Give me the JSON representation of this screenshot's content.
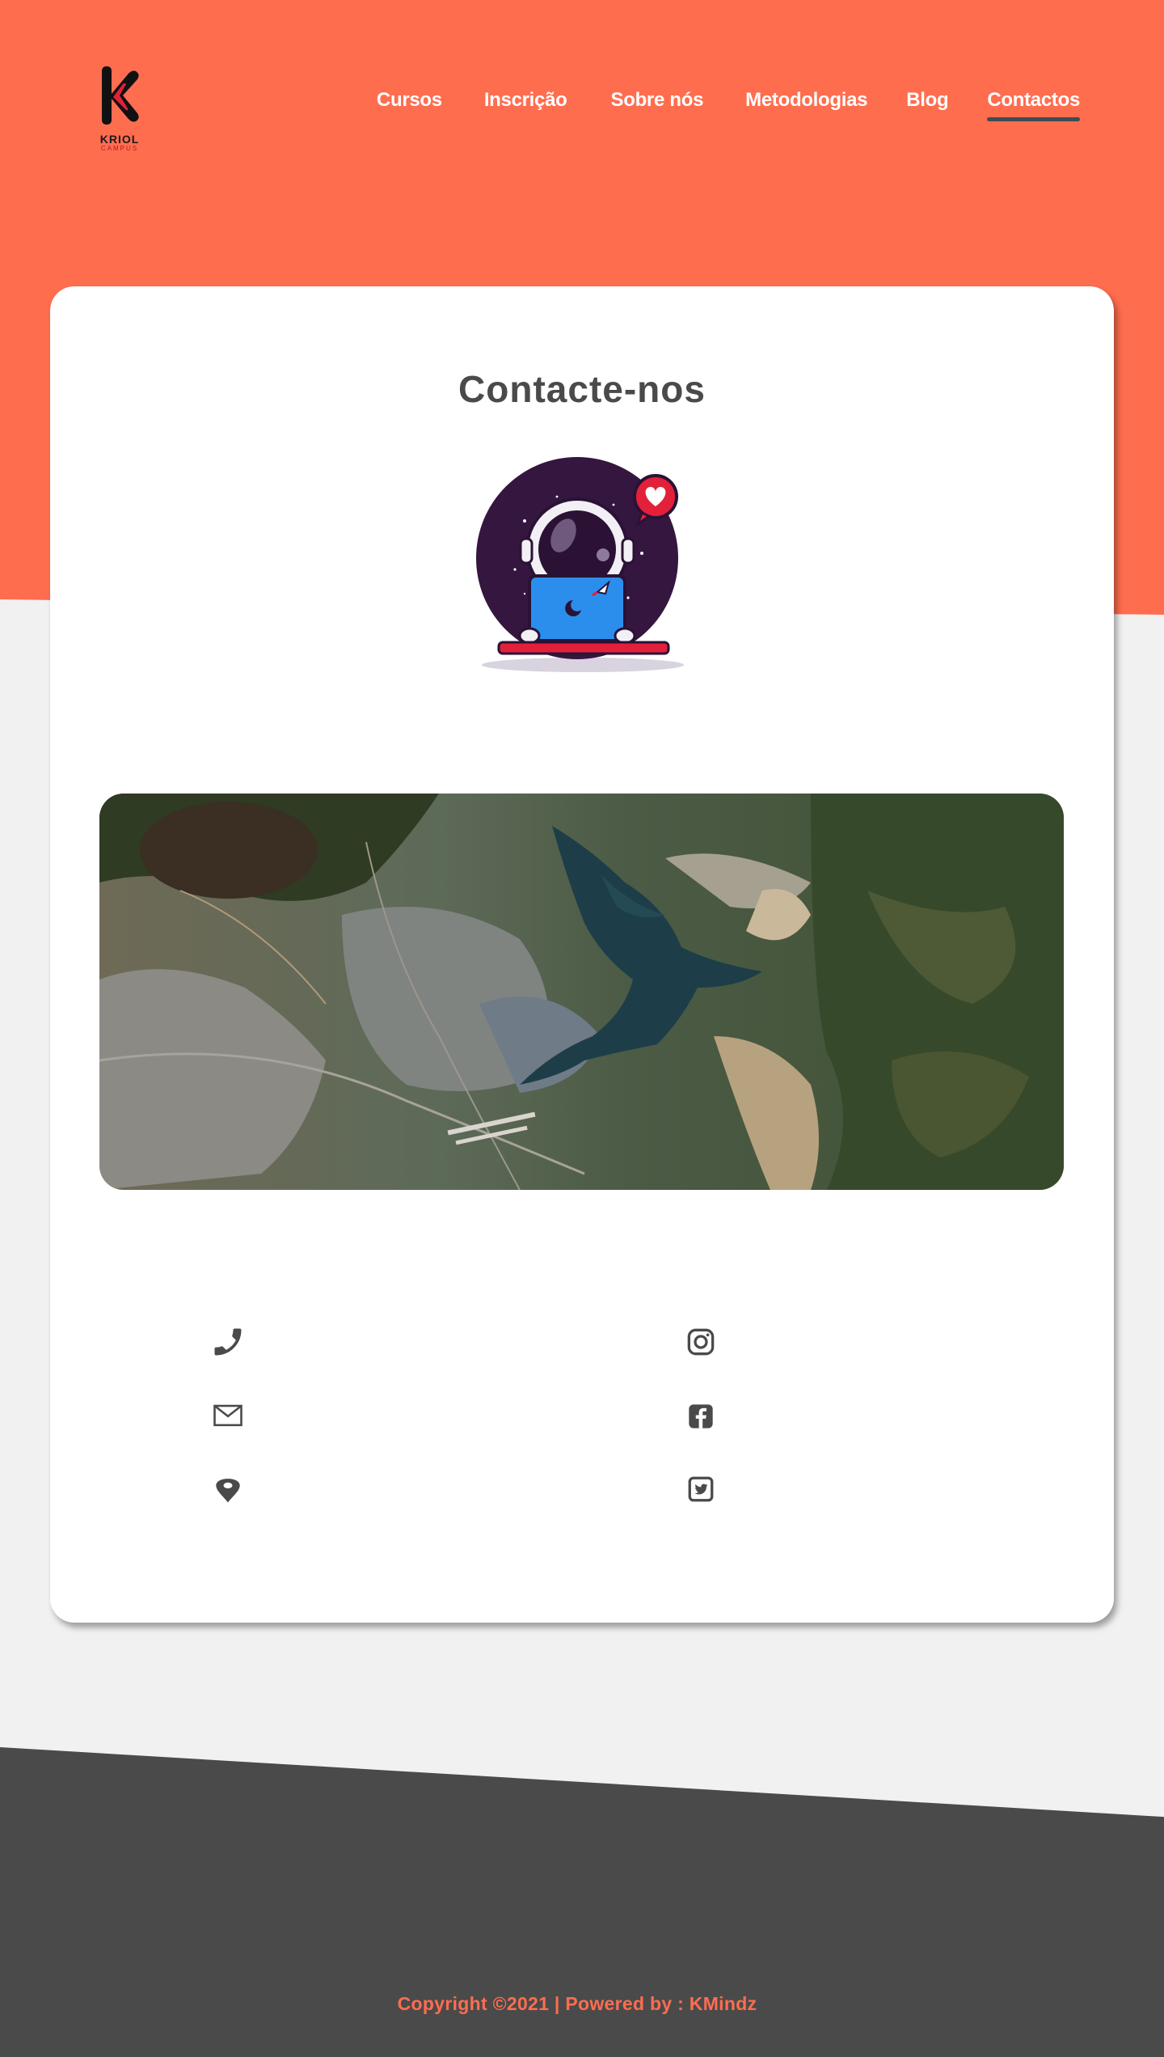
{
  "brand": {
    "logo_text": "KRIOL",
    "logo_sub": "CAMPUS"
  },
  "nav": {
    "items": [
      {
        "label": "Cursos",
        "active": false
      },
      {
        "label": "Inscrição",
        "active": false
      },
      {
        "label": "Sobre nós",
        "active": false
      },
      {
        "label": "Metodologias",
        "active": false
      },
      {
        "label": "Blog",
        "active": false
      },
      {
        "label": "Contactos",
        "active": true
      }
    ]
  },
  "contact": {
    "title": "Contacte-nos",
    "illustration": "astronaut-with-laptop",
    "map": "satellite-map"
  },
  "contact_icons": {
    "left": [
      "phone-icon",
      "mail-icon",
      "location-pin-icon"
    ],
    "right": [
      "instagram-icon",
      "facebook-icon",
      "twitter-icon"
    ]
  },
  "footer": {
    "copyright": "Copyright ©2021 | Powered by : KMindz"
  },
  "colors": {
    "accent": "#ff6d4f",
    "dark": "#4a4a4a",
    "background": "#f1f1f1",
    "card": "#ffffff"
  }
}
